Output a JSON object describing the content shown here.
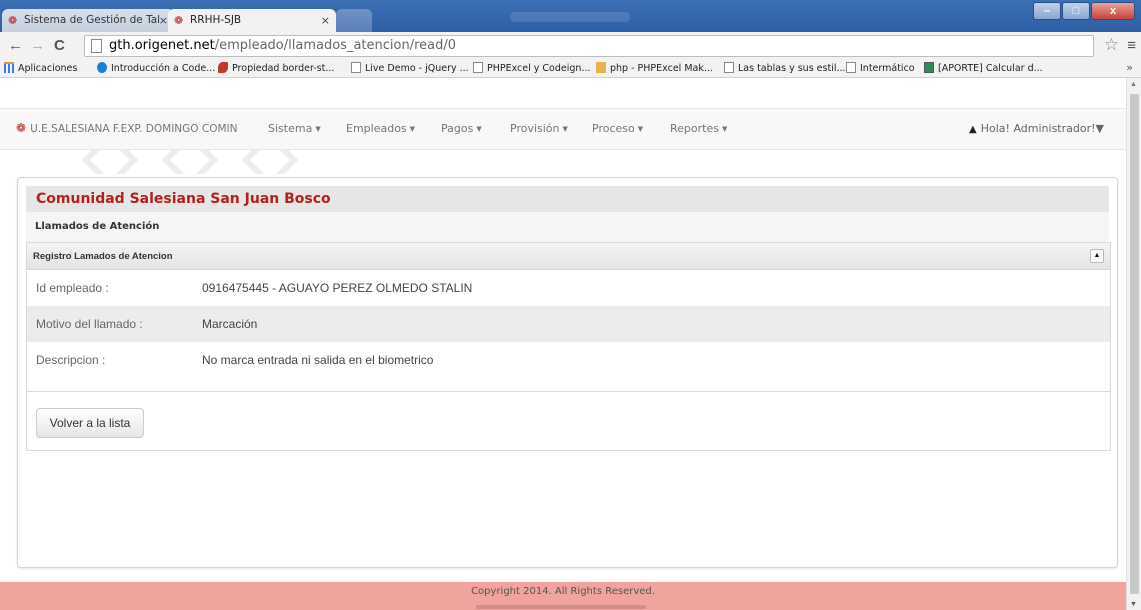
{
  "browser": {
    "tabs": [
      {
        "title": "Sistema de Gestión de Tal"
      },
      {
        "title": "RRHH-SJB"
      }
    ],
    "url_host": "gth.origenet.net",
    "url_path": "/empleado/llamados_atencion/read/0",
    "bookmarks": [
      "Aplicaciones",
      "Introducción a Code...",
      "Propiedad border-st...",
      "Live Demo - jQuery ...",
      "PHPExcel y Codeign...",
      "php - PHPExcel Mak...",
      "Las tablas y sus estil...",
      "Intermático",
      "[APORTE] Calcular d..."
    ]
  },
  "navbar": {
    "brand": "U.E.SALESIANA F.EXP. DOMINGO COMIN",
    "menu": [
      "Sistema",
      "Empleados",
      "Pagos",
      "Provisión",
      "Proceso",
      "Reportes"
    ],
    "user": "Hola! Administrador!"
  },
  "panel": {
    "title": "Comunidad Salesiana San Juan Bosco",
    "subtitle": "Llamados de Atención",
    "box_title": "Registro Lamados de Atencion",
    "fields": [
      {
        "label": "Id empleado :",
        "value": "0916475445 - AGUAYO PEREZ OLMEDO STALIN"
      },
      {
        "label": "Motivo del llamado :",
        "value": "Marcación"
      },
      {
        "label": "Descripcion :",
        "value": "No marca entrada ni salida en el biometrico"
      }
    ],
    "back_button": "Volver a la lista"
  },
  "footer": {
    "copyright": "Copyright 2014. All Rights Reserved."
  },
  "colors": {
    "brand_red": "#b5201c",
    "footer_bg": "#f0a49d",
    "titlebar_blue": "#3c6fb4"
  }
}
